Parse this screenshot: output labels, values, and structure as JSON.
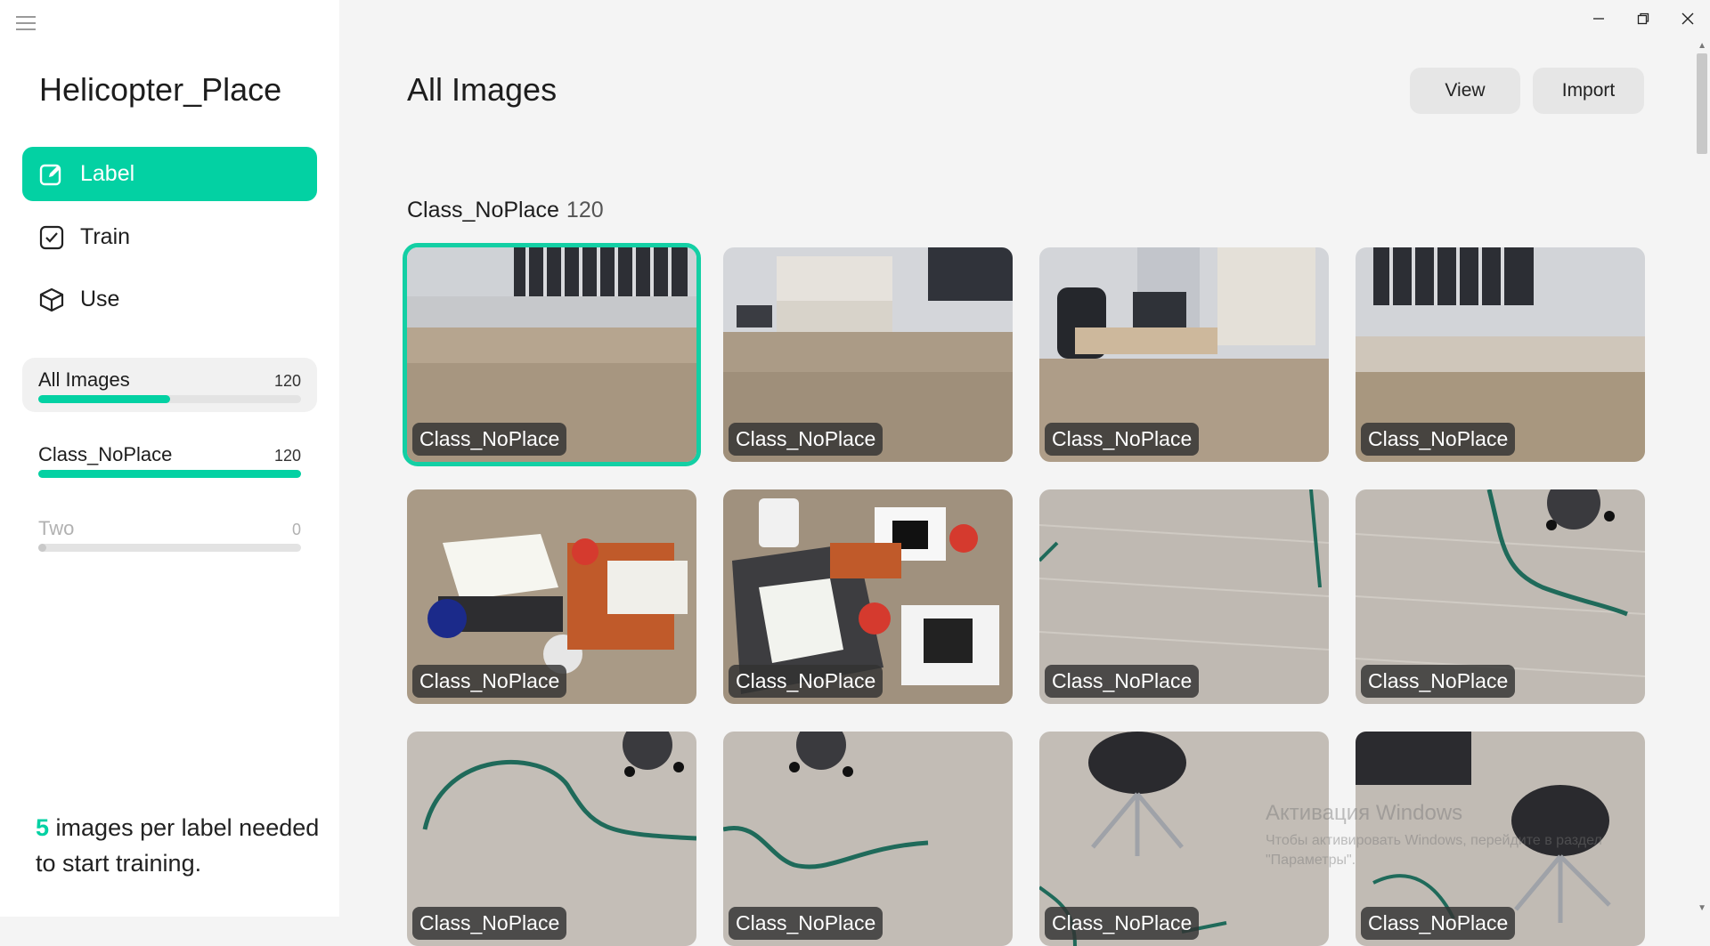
{
  "sidebar": {
    "project_title": "Helicopter_Place",
    "nav": [
      {
        "label": "Label",
        "icon": "edit-icon"
      },
      {
        "label": "Train",
        "icon": "check-square-icon"
      },
      {
        "label": "Use",
        "icon": "cube-icon"
      }
    ],
    "classes": [
      {
        "name": "All Images",
        "count": "120",
        "progress": 0.5
      },
      {
        "name": "Class_NoPlace",
        "count": "120",
        "progress": 1.0
      },
      {
        "name": "Two",
        "count": "0",
        "progress": 0.0
      }
    ],
    "hint_number": "5",
    "hint_text": "images per label needed to start training."
  },
  "main": {
    "title": "All Images",
    "view_button": "View",
    "import_button": "Import",
    "section_name": "Class_NoPlace",
    "section_count": "120",
    "images": [
      {
        "label": "Class_NoPlace"
      },
      {
        "label": "Class_NoPlace"
      },
      {
        "label": "Class_NoPlace"
      },
      {
        "label": "Class_NoPlace"
      },
      {
        "label": "Class_NoPlace"
      },
      {
        "label": "Class_NoPlace"
      },
      {
        "label": "Class_NoPlace"
      },
      {
        "label": "Class_NoPlace"
      },
      {
        "label": "Class_NoPlace"
      },
      {
        "label": "Class_NoPlace"
      },
      {
        "label": "Class_NoPlace"
      },
      {
        "label": "Class_NoPlace"
      }
    ]
  },
  "watermark": {
    "line1": "Активация Windows",
    "line2": "Чтобы активировать Windows, перейдите в раздел",
    "line3": "\"Параметры\"."
  },
  "colors": {
    "accent": "#03d1a3",
    "sidebar_bg": "#ffffff",
    "main_bg": "#f4f4f4"
  }
}
